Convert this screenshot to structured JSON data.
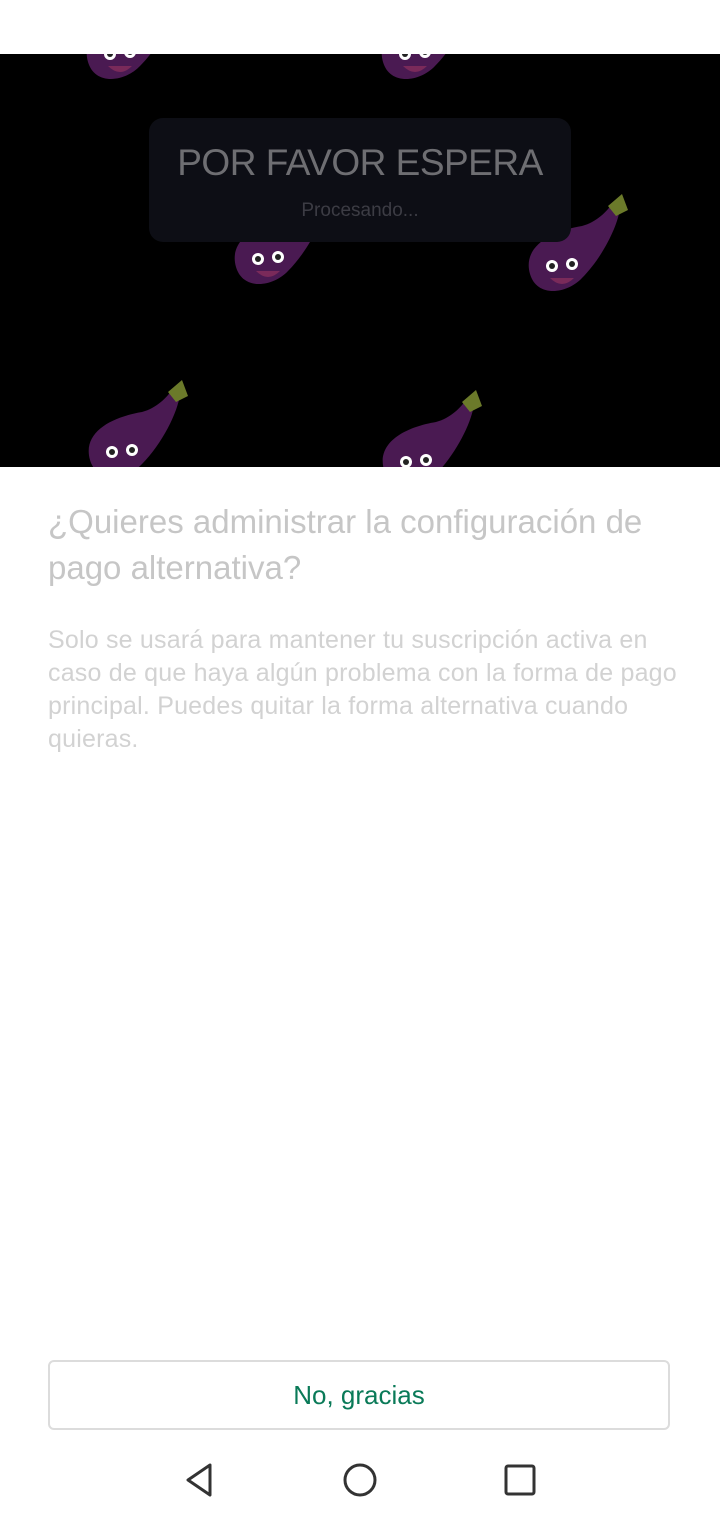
{
  "app": {
    "dialog": {
      "title": "POR FAVOR ESPERA",
      "subtitle": "Procesando..."
    }
  },
  "sheet": {
    "title": "¿Quieres administrar la configuración de pago alternativa?",
    "body": "Solo se usará para mantener tu suscripción activa en caso de que haya algún problema con la forma de pago principal. Puedes quitar la forma alternativa cuando quieras.",
    "decline_label": "No, gracias"
  },
  "colors": {
    "accent": "#0a7a58",
    "eggplant": "#4a1a52",
    "leaf": "#6b7a2a"
  },
  "icons": {
    "background": "eggplant-character-icon",
    "nav_back": "back-triangle-icon",
    "nav_home": "home-circle-icon",
    "nav_recents": "recents-square-icon"
  }
}
